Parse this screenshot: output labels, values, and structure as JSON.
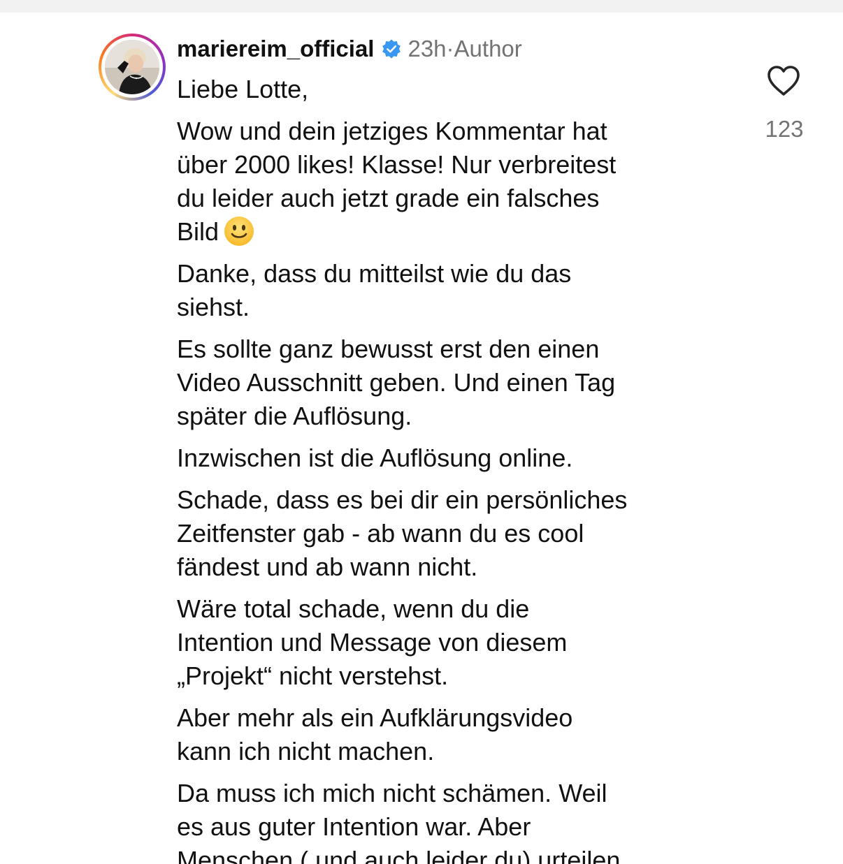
{
  "comment": {
    "username": "mariereim_official",
    "verified": true,
    "timestamp": "23h",
    "separator": "·",
    "role": "Author",
    "like_count": "123",
    "icons": {
      "verified": "verified-badge-icon",
      "like": "heart-outline-icon",
      "emoji": "slightly-smiling-face-emoji"
    },
    "colors": {
      "verified_blue": "#3897f0",
      "meta_gray": "#737373",
      "text": "#111111"
    },
    "paragraphs": {
      "p1": "Liebe Lotte,",
      "p2": "Wow und dein jetziges Kommentar hat\nüber 2000 likes! Klasse! Nur verbreitest\ndu leider auch jetzt grade ein falsches\nBild",
      "p3": "Danke, dass du mitteilst wie du das\nsiehst.",
      "p4": "Es sollte ganz bewusst erst den einen\nVideo Ausschnitt geben. Und einen Tag\nspäter die Auflösung.",
      "p5": "Inzwischen ist die Auflösung online.",
      "p6": "Schade, dass es bei dir ein persönliches\nZeitfenster gab - ab wann du es cool\nfändest und ab wann nicht.",
      "p7": "Wäre total schade, wenn du die\nIntention und Message von diesem\n„Projekt“ nicht verstehst.",
      "p8": "Aber mehr als ein Aufklärungsvideo\nkann ich nicht machen.",
      "p9": "Da muss ich mich nicht schämen. Weil\nes aus guter Intention war. Aber\nMenschen ( und auch leider du) urteilen"
    }
  }
}
